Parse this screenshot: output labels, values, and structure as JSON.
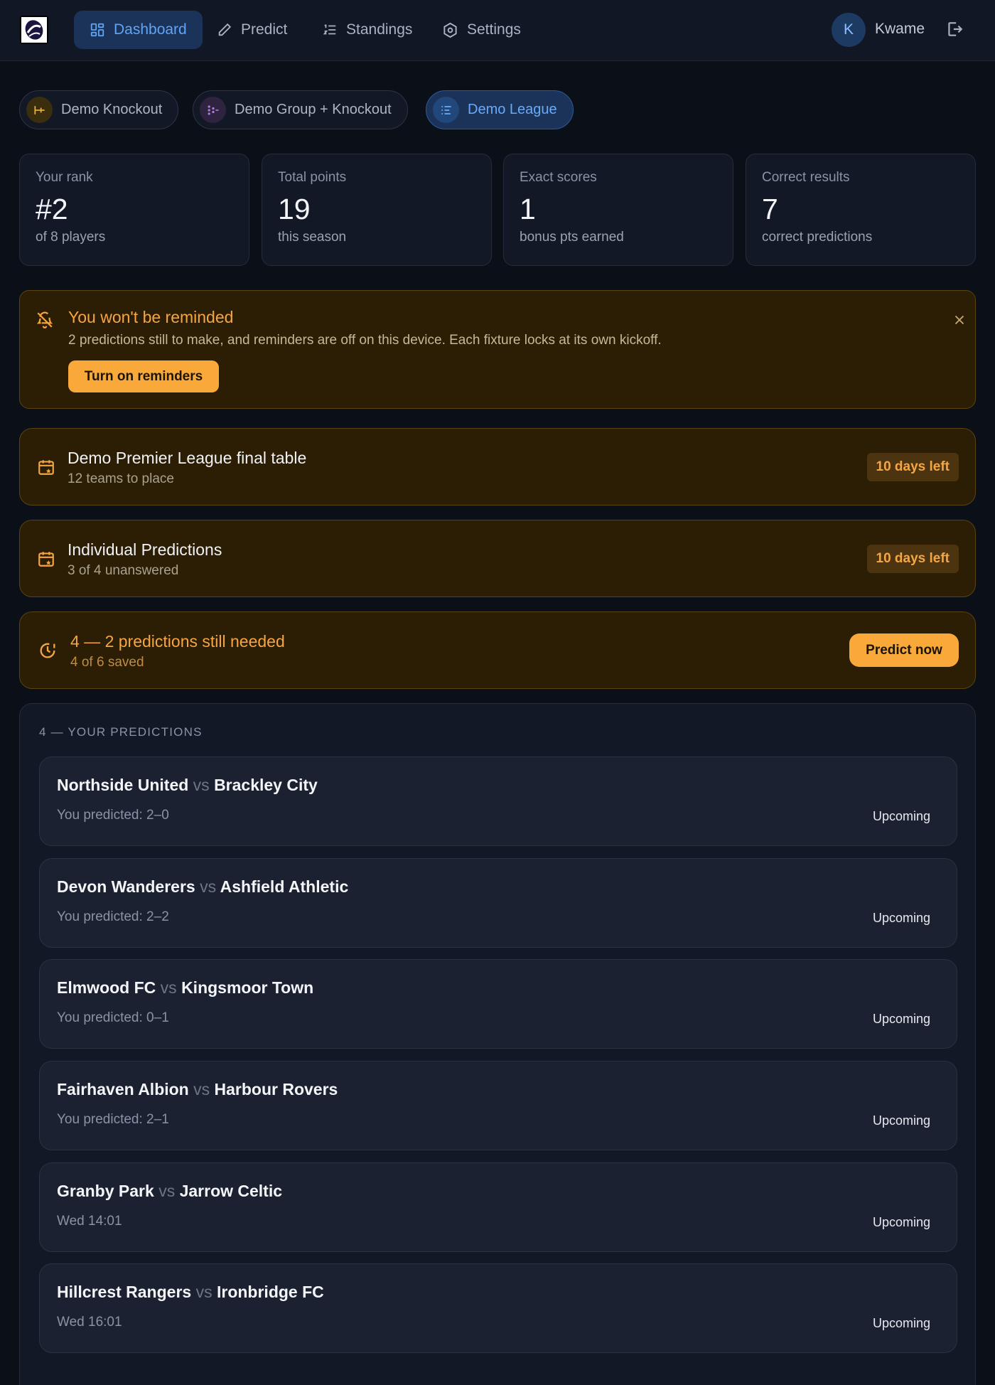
{
  "nav": {
    "items": [
      {
        "label": "Dashboard",
        "icon": "dashboard-icon",
        "active": true
      },
      {
        "label": "Predict",
        "icon": "pencil-icon"
      },
      {
        "label": "Standings",
        "icon": "list-ordered-icon"
      },
      {
        "label": "Settings",
        "icon": "gear-icon"
      }
    ],
    "user": {
      "initial": "K",
      "name": "Kwame"
    }
  },
  "competitions": [
    {
      "label": "Demo Knockout",
      "icon": "bracket-icon"
    },
    {
      "label": "Demo Group + Knockout",
      "icon": "group-knockout-icon"
    },
    {
      "label": "Demo League",
      "icon": "league-table-icon",
      "active": true
    }
  ],
  "stats": [
    {
      "label": "Your rank",
      "value": "#2",
      "sub": "of 8 players"
    },
    {
      "label": "Total points",
      "value": "19",
      "sub": "this season"
    },
    {
      "label": "Exact scores",
      "value": "1",
      "sub": "bonus pts earned"
    },
    {
      "label": "Correct results",
      "value": "7",
      "sub": "correct predictions"
    }
  ],
  "reminder": {
    "title": "You won't be reminded",
    "text": "2 predictions still to make, and reminders are off on this device. Each fixture locks at its own kickoff.",
    "button": "Turn on reminders"
  },
  "deadlines": [
    {
      "title": "Demo Premier League final table",
      "sub": "12 teams to place",
      "badge": "10 days left"
    },
    {
      "title": "Individual Predictions",
      "sub": "3 of 4 unanswered",
      "badge": "10 days left"
    }
  ],
  "needed": {
    "title": "4 — 2 predictions still needed",
    "sub": "4 of 6 saved",
    "button": "Predict now"
  },
  "predictions": {
    "title": "4 — YOUR PREDICTIONS",
    "vs": "vs",
    "matches": [
      {
        "home": "Northside United",
        "away": "Brackley City",
        "detail": "You predicted: 2–0",
        "status": "Upcoming"
      },
      {
        "home": "Devon Wanderers",
        "away": "Ashfield Athletic",
        "detail": "You predicted: 2–2",
        "status": "Upcoming"
      },
      {
        "home": "Elmwood FC",
        "away": "Kingsmoor Town",
        "detail": "You predicted: 0–1",
        "status": "Upcoming"
      },
      {
        "home": "Fairhaven Albion",
        "away": "Harbour Rovers",
        "detail": "You predicted: 2–1",
        "status": "Upcoming"
      },
      {
        "home": "Granby Park",
        "away": "Jarrow Celtic",
        "detail": "Wed 14:01",
        "status": "Upcoming"
      },
      {
        "home": "Hillcrest Rangers",
        "away": "Ironbridge FC",
        "detail": "Wed 16:01",
        "status": "Upcoming"
      }
    ]
  },
  "colors": {
    "accent": "#5fa4f5",
    "warning": "#f5a643",
    "warning_bg": "#2b1e04",
    "background": "#0b0f18",
    "card": "#121826"
  }
}
